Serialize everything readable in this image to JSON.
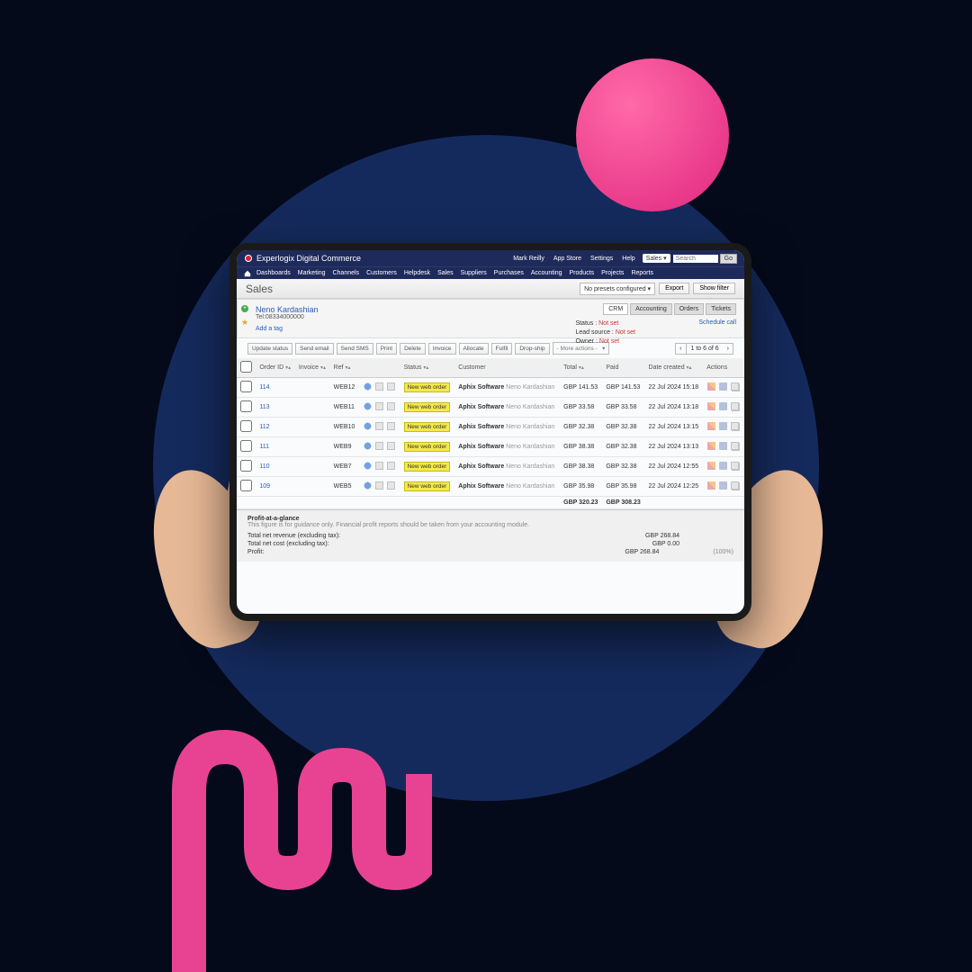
{
  "header": {
    "app_title": "Experlogix Digital Commerce",
    "user": "Mark Reilly",
    "links": [
      "App Store",
      "Settings",
      "Help"
    ],
    "context_select": "Sales",
    "search_placeholder": "Search",
    "go": "Go"
  },
  "nav": [
    "Dashboards",
    "Marketing",
    "Channels",
    "Customers",
    "Helpdesk",
    "Sales",
    "Suppliers",
    "Purchases",
    "Accounting",
    "Products",
    "Projects",
    "Reports"
  ],
  "page": {
    "title": "Sales",
    "presets": "No presets configured",
    "export": "Export",
    "show_filter": "Show filter"
  },
  "customer": {
    "name": "Neno Kardashian",
    "tel_label": "Tel:",
    "tel": "08334000000",
    "add_tag": "Add a tag",
    "tabs": [
      "CRM",
      "Accounting",
      "Orders",
      "Tickets"
    ],
    "status_label": "Status :",
    "lead_label": "Lead source :",
    "owner_label": "Owner :",
    "not_set": "Not set",
    "schedule": "Schedule call"
  },
  "action_buttons": [
    "Update status",
    "Send email",
    "Send SMS",
    "Print",
    "Delete",
    "Invoice",
    "Allocate",
    "Fulfil",
    "Drop-ship"
  ],
  "more_actions": "- More actions -",
  "pager": {
    "text": "1 to 6 of 6"
  },
  "columns": [
    "",
    "Order ID",
    "Invoice",
    "Ref",
    "",
    "Status",
    "Customer",
    "Total",
    "Paid",
    "Date created",
    "Actions"
  ],
  "rows": [
    {
      "id": "114",
      "ref": "WEB12",
      "status": "New web order",
      "company": "Aphix Software",
      "contact": "Neno Kardashian",
      "total": "GBP 141.53",
      "paid": "GBP 141.53",
      "date": "22 Jul 2024 15:18"
    },
    {
      "id": "113",
      "ref": "WEB11",
      "status": "New web order",
      "company": "Aphix Software",
      "contact": "Neno Kardashian",
      "total": "GBP 33.58",
      "paid": "GBP 33.58",
      "date": "22 Jul 2024 13:18"
    },
    {
      "id": "112",
      "ref": "WEB10",
      "status": "New web order",
      "company": "Aphix Software",
      "contact": "Neno Kardashian",
      "total": "GBP 32.38",
      "paid": "GBP 32.38",
      "date": "22 Jul 2024 13:15"
    },
    {
      "id": "111",
      "ref": "WEB9",
      "status": "New web order",
      "company": "Aphix Software",
      "contact": "Neno Kardashian",
      "total": "GBP 38.38",
      "paid": "GBP 32.38",
      "date": "22 Jul 2024 13:13"
    },
    {
      "id": "110",
      "ref": "WEB7",
      "status": "New web order",
      "company": "Aphix Software",
      "contact": "Neno Kardashian",
      "total": "GBP 38.38",
      "paid": "GBP 32.38",
      "date": "22 Jul 2024 12:55"
    },
    {
      "id": "109",
      "ref": "WEB5",
      "status": "New web order",
      "company": "Aphix Software",
      "contact": "Neno Kardashian",
      "total": "GBP 35.98",
      "paid": "GBP 35.98",
      "date": "22 Jul 2024 12:25"
    }
  ],
  "totals": {
    "total": "GBP 320.23",
    "paid": "GBP 308.23"
  },
  "profit": {
    "heading": "Profit-at-a-glance",
    "note": "This figure is for guidance only. Financial profit reports should be taken from your accounting module.",
    "rows": [
      {
        "label": "Total net revenue (excluding tax):",
        "value": "GBP 268.84",
        "pct": ""
      },
      {
        "label": "Total net cost (excluding tax):",
        "value": "GBP 0.00",
        "pct": ""
      },
      {
        "label": "Profit:",
        "value": "GBP 268.84",
        "pct": "(100%)"
      }
    ]
  }
}
